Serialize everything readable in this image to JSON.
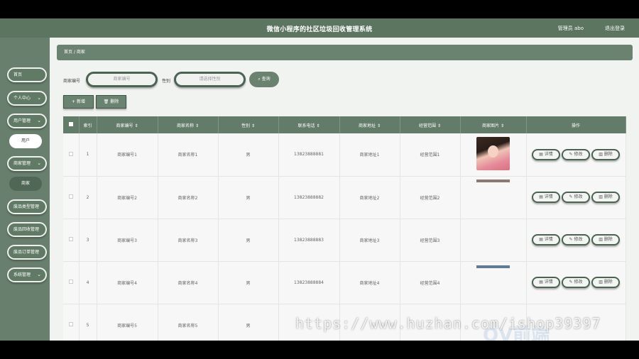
{
  "header": {
    "title": "微信小程序的社区垃圾回收管理系统",
    "user": "管理员 abo",
    "logout": "退出登录"
  },
  "sidebar": {
    "items": [
      {
        "label": "首页",
        "chevron": ""
      },
      {
        "label": "个人中心",
        "chevron": "⌄"
      },
      {
        "label": "用户管理",
        "chevron": "⌄"
      },
      {
        "label": "用户",
        "sub": true,
        "style": "light"
      },
      {
        "label": "商家管理",
        "chevron": "⌄"
      },
      {
        "label": "商家",
        "sub": true,
        "style": "dark"
      },
      {
        "label": "废品类型管理",
        "chevron": "⌄"
      },
      {
        "label": "废品回收管理",
        "chevron": "⌄"
      },
      {
        "label": "废品订单管理",
        "chevron": "⌄"
      },
      {
        "label": "系统管理",
        "chevron": "⌄"
      }
    ]
  },
  "breadcrumb": {
    "home": "首页",
    "sep": "/",
    "current": "商家"
  },
  "search": {
    "merchant_no_label": "商家编号",
    "merchant_no_placeholder": "商家编号",
    "gender_label": "性别",
    "gender_placeholder": "请选择性别",
    "query_label": "查询",
    "query_icon": "search-icon"
  },
  "toolbar": {
    "add_label": "+ 新增",
    "delete_label": "删除"
  },
  "table": {
    "headers": [
      "",
      "索引",
      "商家编号 ⇕",
      "商家名称 ⇕",
      "性别 ⇕",
      "联系电话 ⇕",
      "商家地址 ⇕",
      "经营范围 ⇕",
      "商家图片 ⇕",
      "操作"
    ],
    "rows": [
      {
        "index": "1",
        "no": "商家编号1",
        "name": "商家名称1",
        "gender": "男",
        "phone": "13823888881",
        "address": "商家地址1",
        "scope": "经营范围1"
      },
      {
        "index": "2",
        "no": "商家编号2",
        "name": "商家名称2",
        "gender": "男",
        "phone": "13823888882",
        "address": "商家地址2",
        "scope": "经营范围2"
      },
      {
        "index": "3",
        "no": "商家编号3",
        "name": "商家名称3",
        "gender": "男",
        "phone": "13823888883",
        "address": "商家地址3",
        "scope": "经营范围3"
      },
      {
        "index": "4",
        "no": "商家编号4",
        "name": "商家名称4",
        "gender": "男",
        "phone": "13823888884",
        "address": "商家地址4",
        "scope": "经营范围4"
      },
      {
        "index": "5",
        "no": "商家编号5",
        "name": "商家名称5",
        "gender": "男",
        "phone": "",
        "address": "",
        "scope": ""
      }
    ],
    "actions": {
      "detail": "详情",
      "edit": "修改",
      "delete": "删除"
    }
  },
  "watermark": {
    "url": "https://www.huzhan.com/ishop39397",
    "logo": "QV前端"
  }
}
